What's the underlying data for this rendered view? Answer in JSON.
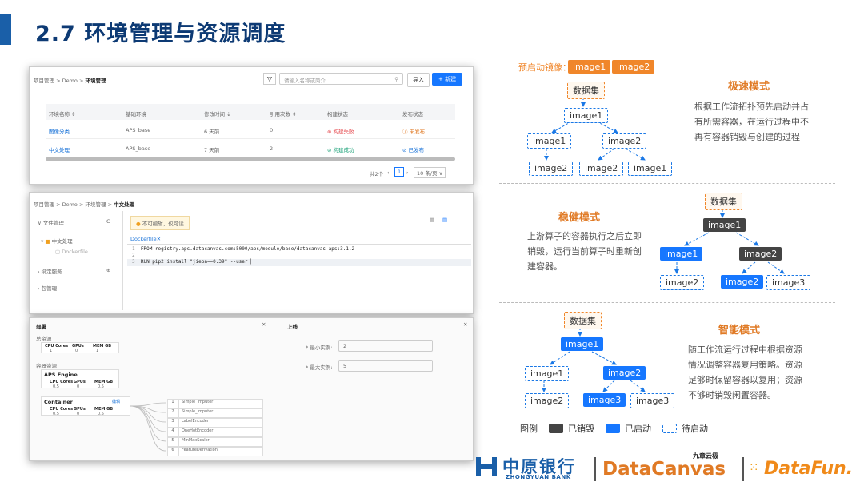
{
  "slide": {
    "title": "2.7 环境管理与资源调度"
  },
  "panel1": {
    "breadcrumb": [
      "项目管理",
      "Demo",
      "环境管理"
    ],
    "search_placeholder": "请输入名称或简介",
    "import_label": "导入",
    "new_label": "+ 新建",
    "columns": [
      "环境名称 ⇕",
      "基础环境",
      "修改时间 ⇣",
      "引用次数 ⇕",
      "构建状态",
      "发布状态"
    ],
    "rows": [
      {
        "name": "图像分类",
        "base": "APS_base",
        "time": "6 天前",
        "refs": "0",
        "build": "⊗ 构建失败",
        "publish": "ⓘ 未发布"
      },
      {
        "name": "中文处理",
        "base": "APS_base",
        "time": "7 天前",
        "refs": "2",
        "build": "⊘ 构建成功",
        "publish": "⊘ 已发布"
      }
    ],
    "pagination": {
      "total": "共2个",
      "page": "1",
      "size": "10 条/页"
    }
  },
  "panel2": {
    "breadcrumb": [
      "项目管理",
      "Demo",
      "环境管理",
      "中文处理"
    ],
    "sidebar": {
      "file_mgmt": "文件管理",
      "folder": "中文处理",
      "file": "Dockerfile",
      "bind": "绑定服务",
      "pkg": "包管理"
    },
    "warning": "不可编辑，仅可读",
    "file_tab": "Dockerfile",
    "code": [
      {
        "n": "1",
        "t": "FROM registry.aps.datacanvas.com:5000/aps/module/base/datacanvas-aps:3.1.2"
      },
      {
        "n": "2",
        "t": ""
      },
      {
        "n": "3",
        "t": "RUN pip2 install \"jieba==0.39\" --user"
      }
    ]
  },
  "panel3": {
    "left_title": "部署",
    "right_title": "上线",
    "total_res": "总资源",
    "res_labels": [
      "CPU Cores",
      "GPUs",
      "MEM GB"
    ],
    "res_vals": [
      "1",
      "0",
      "1"
    ],
    "container_res": "容器资源",
    "engine": "APS Engine",
    "engine_vals": [
      "0.5",
      "0",
      "0.5"
    ],
    "container": "Container",
    "container_link": "编辑",
    "container_vals": [
      "0.5",
      "0",
      "0.5"
    ],
    "min_label": "* 最小实例:",
    "min_val": "2",
    "max_label": "* 最大实例:",
    "max_val": "5",
    "steps": [
      {
        "n": "1",
        "name": "Simple_Imputer"
      },
      {
        "n": "2",
        "name": "Simple_Imputer"
      },
      {
        "n": "3",
        "name": "LabelEncoder"
      },
      {
        "n": "4",
        "name": "OneHotEncoder"
      },
      {
        "n": "5",
        "name": "MinMaxScaler"
      },
      {
        "n": "6",
        "name": "FeatureDerivation"
      }
    ]
  },
  "preload": {
    "label": "预启动镜像：",
    "images": [
      "image1",
      "image2"
    ]
  },
  "mode1": {
    "title": "极速模式",
    "desc": "根据工作流拓扑预先启动并占有所需容器，在运行过程中不再有容器销毁与创建的过程",
    "dataset": "数据集",
    "nodes": [
      "image1",
      "image1",
      "image2",
      "image2",
      "image2",
      "image1"
    ]
  },
  "mode2": {
    "title": "稳健模式",
    "desc": "上游算子的容器执行之后立即销毁，运行当前算子时重新创建容器。",
    "dataset": "数据集",
    "nodes": [
      "image1",
      "image1",
      "image2",
      "image2",
      "image2",
      "image3"
    ]
  },
  "mode3": {
    "title": "智能模式",
    "desc": "随工作流运行过程中根据资源情况调整容器复用策略。资源足够时保留容器以复用；资源不够时销毁闲置容器。",
    "dataset": "数据集",
    "nodes": [
      "image1",
      "image1",
      "image2",
      "image2",
      "image3",
      "image3"
    ]
  },
  "legend": {
    "label": "图例",
    "destroyed": "已销毁",
    "started": "已启动",
    "pending": "待启动"
  },
  "logos": {
    "bank_cn": "中原银行",
    "bank_en": "ZHONGYUAN BANK",
    "dc_top": "九章云极",
    "dc": "DataCanvas",
    "df": "DataFun."
  },
  "colors": {
    "accent": "#1677ff",
    "orange": "#f0862a",
    "dark": "#444444",
    "title": "#0d3a74"
  }
}
